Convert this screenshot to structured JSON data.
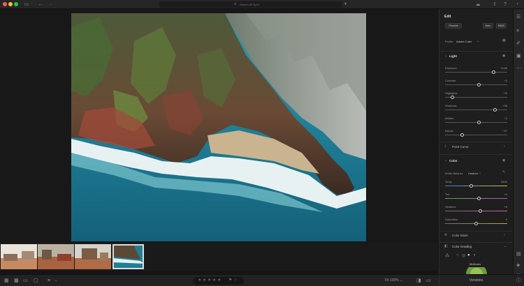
{
  "search": {
    "placeholder": "Search All Sync"
  },
  "panel": {
    "title": "Edit",
    "profile_btn": "Presets",
    "auto_btn": "Auto",
    "bw_btn": "B&W",
    "profile_label": "Profile",
    "profile_value": "Adobe Color",
    "light": {
      "title": "Light",
      "sliders": [
        {
          "label": "Exposure",
          "value": "+0.68",
          "position": 0.78
        },
        {
          "label": "Contrast",
          "value": "+3",
          "position": 0.55
        },
        {
          "label": "Highlights",
          "value": "−76",
          "position": 0.12
        },
        {
          "label": "Shadows",
          "value": "+38",
          "position": 0.8
        },
        {
          "label": "Whites",
          "value": "+3",
          "position": 0.55
        },
        {
          "label": "Blacks",
          "value": "−37",
          "position": 0.28
        }
      ]
    },
    "point_curve": "Point Curve",
    "color": {
      "title": "Color",
      "wb_label": "White Balance",
      "wb_value": "Custom",
      "sliders": [
        {
          "label": "Temp",
          "value": "5400",
          "position": 0.42,
          "colors": [
            "#3a7bd5",
            "#e2c044"
          ]
        },
        {
          "label": "Tint",
          "value": "+4",
          "position": 0.55,
          "colors": [
            "#4caf50",
            "#c94fc9"
          ]
        },
        {
          "label": "Vibrance",
          "value": "+9",
          "position": 0.57,
          "colors": [
            "#6b6b6b",
            "#d95f9a"
          ]
        },
        {
          "label": "Saturation",
          "value": "0",
          "position": 0.5,
          "colors": [
            "#6b6b6b",
            "#b7b040"
          ]
        }
      ]
    },
    "color_mixer": "Color Mixer",
    "color_grading": "Color Grading",
    "midtones": "Midtones"
  },
  "bottom": {
    "fit_label": "Fit",
    "zoom": "100%",
    "versions": "Versions",
    "stars": [
      "★",
      "★",
      "★",
      "★",
      "★"
    ]
  },
  "colors": {
    "panel_bg": "#1e1e1e",
    "canvas_bg": "#181818"
  }
}
